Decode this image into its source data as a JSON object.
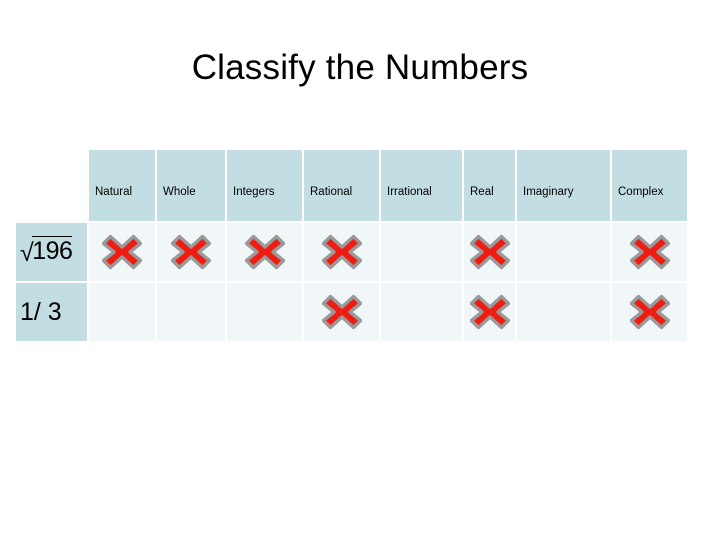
{
  "slide": {
    "title": "Classify the Numbers",
    "background_color": "#ffffff"
  },
  "colors": {
    "header_fill": "#c3dee2",
    "row_label_fill": "#c3dee2",
    "cell_fill": "#f1f7f8",
    "x_mark_red": "#ee1c11",
    "x_mark_border": "#9a9a9a",
    "text": "#000000"
  },
  "table": {
    "corner_label": "",
    "columns": [
      {
        "key": "natural",
        "label": "Natural"
      },
      {
        "key": "whole",
        "label": "Whole"
      },
      {
        "key": "integers",
        "label": "Integers"
      },
      {
        "key": "rational",
        "label": "Rational"
      },
      {
        "key": "irrational",
        "label": "Irrational"
      },
      {
        "key": "real",
        "label": "Real"
      },
      {
        "key": "imaginary",
        "label": "Imaginary"
      },
      {
        "key": "complex",
        "label": "Complex"
      }
    ],
    "rows": [
      {
        "key": "sqrt196",
        "label": "√196",
        "label_kind": "radical",
        "radicand": "196",
        "marks": {
          "natural": true,
          "whole": true,
          "integers": true,
          "rational": true,
          "irrational": false,
          "real": true,
          "imaginary": false,
          "complex": true
        }
      },
      {
        "key": "one_third",
        "label": "1/ 3",
        "label_kind": "plain",
        "radicand": "",
        "marks": {
          "natural": false,
          "whole": false,
          "integers": false,
          "rational": true,
          "irrational": false,
          "real": true,
          "imaginary": false,
          "complex": true
        }
      }
    ]
  },
  "icons": {
    "x_mark": "x-mark-icon"
  }
}
